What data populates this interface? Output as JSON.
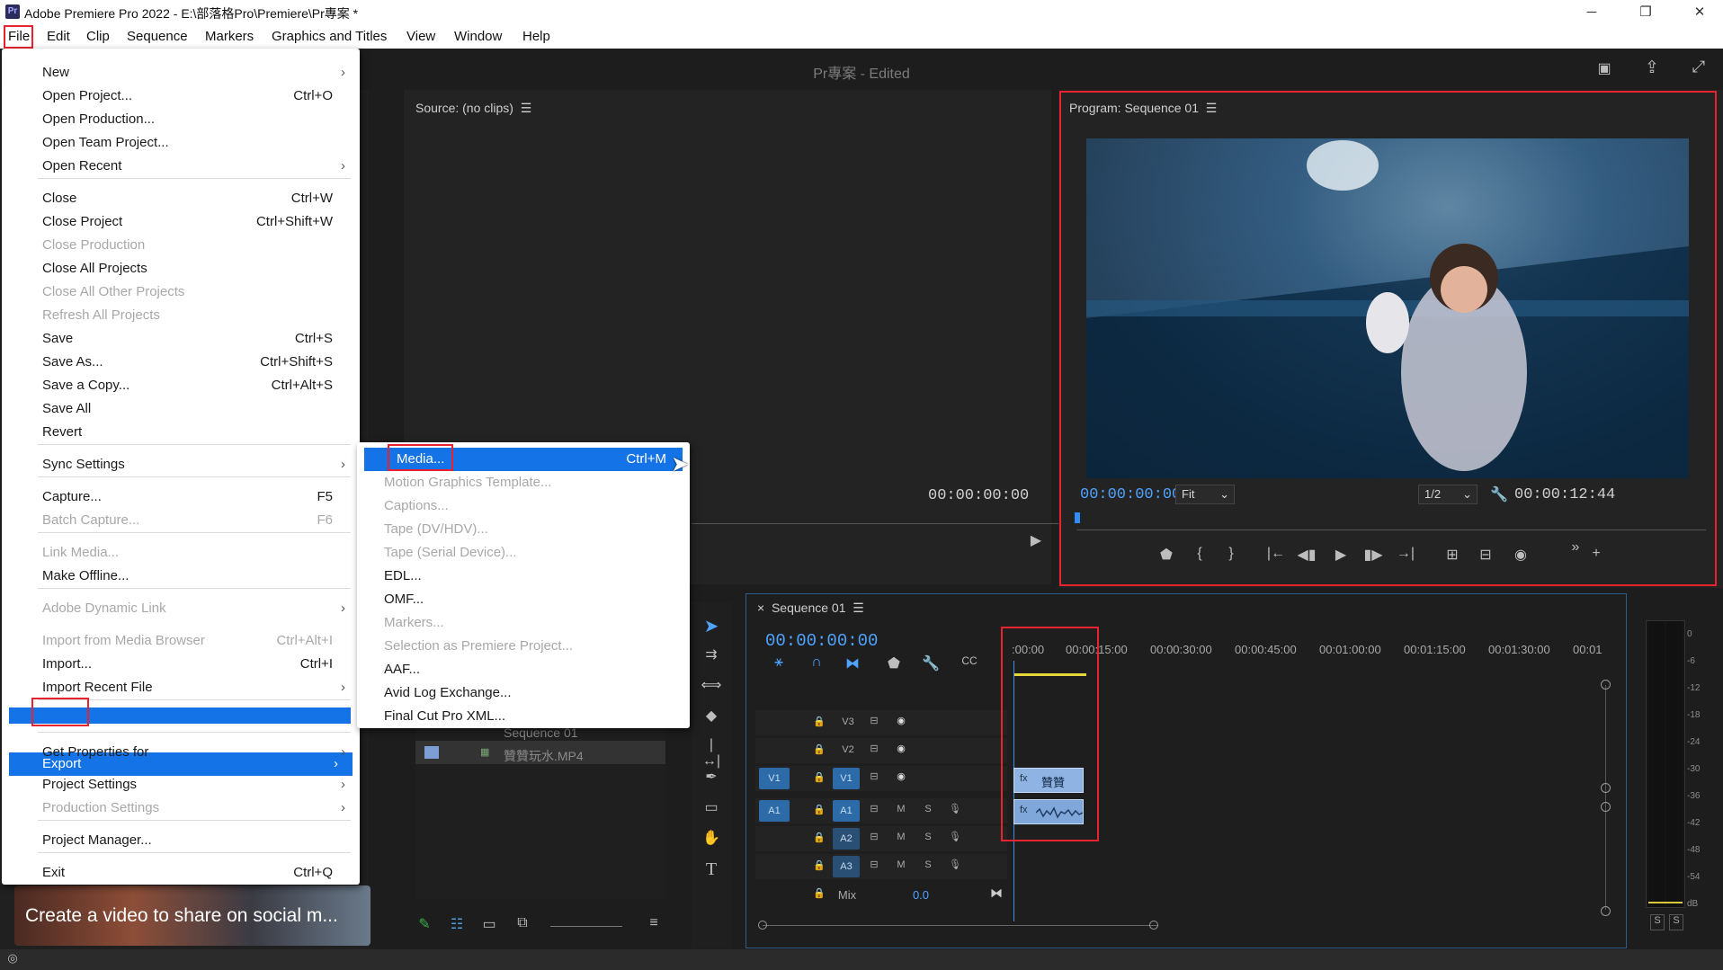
{
  "window": {
    "title": "Adobe Premiere Pro 2022 - E:\\部落格Pro\\Premiere\\Pr專案 *",
    "logo": "Pr",
    "minimize": "─",
    "maximize": "❐",
    "close": "✕"
  },
  "menubar": [
    "File",
    "Edit",
    "Clip",
    "Sequence",
    "Markers",
    "Graphics and Titles",
    "View",
    "Window",
    "Help"
  ],
  "appbar": {
    "project_name": "Pr專案",
    "status": " - Edited"
  },
  "file_menu": [
    {
      "label": "New",
      "sc": "",
      "sub": true,
      "dis": false
    },
    {
      "label": "Open Project...",
      "sc": "Ctrl+O",
      "sub": false,
      "dis": false
    },
    {
      "label": "Open Production...",
      "sc": "",
      "sub": false,
      "dis": false
    },
    {
      "label": "Open Team Project...",
      "sc": "",
      "sub": false,
      "dis": false
    },
    {
      "label": "Open Recent",
      "sc": "",
      "sub": true,
      "dis": false
    },
    {
      "label": "Close",
      "sc": "Ctrl+W",
      "sub": false,
      "dis": false
    },
    {
      "label": "Close Project",
      "sc": "Ctrl+Shift+W",
      "sub": false,
      "dis": false
    },
    {
      "label": "Close Production",
      "sc": "",
      "sub": false,
      "dis": true
    },
    {
      "label": "Close All Projects",
      "sc": "",
      "sub": false,
      "dis": false
    },
    {
      "label": "Close All Other Projects",
      "sc": "",
      "sub": false,
      "dis": true
    },
    {
      "label": "Refresh All Projects",
      "sc": "",
      "sub": false,
      "dis": true
    },
    {
      "label": "Save",
      "sc": "Ctrl+S",
      "sub": false,
      "dis": false
    },
    {
      "label": "Save As...",
      "sc": "Ctrl+Shift+S",
      "sub": false,
      "dis": false
    },
    {
      "label": "Save a Copy...",
      "sc": "Ctrl+Alt+S",
      "sub": false,
      "dis": false
    },
    {
      "label": "Save All",
      "sc": "",
      "sub": false,
      "dis": false
    },
    {
      "label": "Revert",
      "sc": "",
      "sub": false,
      "dis": false
    },
    {
      "label": "Sync Settings",
      "sc": "",
      "sub": true,
      "dis": false
    },
    {
      "label": "Capture...",
      "sc": "F5",
      "sub": false,
      "dis": false
    },
    {
      "label": "Batch Capture...",
      "sc": "F6",
      "sub": false,
      "dis": true
    },
    {
      "label": "Link Media...",
      "sc": "",
      "sub": false,
      "dis": true
    },
    {
      "label": "Make Offline...",
      "sc": "",
      "sub": false,
      "dis": false
    },
    {
      "label": "Adobe Dynamic Link",
      "sc": "",
      "sub": true,
      "dis": true
    },
    {
      "label": "Import from Media Browser",
      "sc": "Ctrl+Alt+I",
      "sub": false,
      "dis": true
    },
    {
      "label": "Import...",
      "sc": "Ctrl+I",
      "sub": false,
      "dis": false
    },
    {
      "label": "Import Recent File",
      "sc": "",
      "sub": true,
      "dis": false
    },
    {
      "label": "Export",
      "sc": "",
      "sub": true,
      "dis": false
    },
    {
      "label": "Get Properties for",
      "sc": "",
      "sub": true,
      "dis": false
    },
    {
      "label": "Project Settings",
      "sc": "",
      "sub": true,
      "dis": false
    },
    {
      "label": "Production Settings",
      "sc": "",
      "sub": true,
      "dis": true
    },
    {
      "label": "Project Manager...",
      "sc": "",
      "sub": false,
      "dis": false
    },
    {
      "label": "Exit",
      "sc": "Ctrl+Q",
      "sub": false,
      "dis": false
    }
  ],
  "export_menu": [
    {
      "label": "Media...",
      "sc": "Ctrl+M",
      "dis": false
    },
    {
      "label": "Motion Graphics Template...",
      "sc": "",
      "dis": true
    },
    {
      "label": "Captions...",
      "sc": "",
      "dis": true
    },
    {
      "label": "Tape (DV/HDV)...",
      "sc": "",
      "dis": true
    },
    {
      "label": "Tape (Serial Device)...",
      "sc": "",
      "dis": true
    },
    {
      "label": "EDL...",
      "sc": "",
      "dis": false
    },
    {
      "label": "OMF...",
      "sc": "",
      "dis": false
    },
    {
      "label": "Markers...",
      "sc": "",
      "dis": true
    },
    {
      "label": "Selection as Premiere Project...",
      "sc": "",
      "dis": true
    },
    {
      "label": "AAF...",
      "sc": "",
      "dis": false
    },
    {
      "label": "Avid Log Exchange...",
      "sc": "",
      "dis": false
    },
    {
      "label": "Final Cut Pro XML...",
      "sc": "",
      "dis": false
    }
  ],
  "source": {
    "title": "Source: (no clips)",
    "timecode": "00:00:00:00"
  },
  "program": {
    "title": "Program: Sequence 01",
    "timecode_left": "00:00:00:00",
    "fit": "Fit",
    "resolution": "1/2",
    "timecode_right": "00:00:12:44"
  },
  "project": {
    "items": [
      "Sequence 01",
      "贊贊玩水.MP4"
    ],
    "learn_banner": "Create a video to share on social m..."
  },
  "timeline": {
    "tab": "Sequence 01",
    "timecode": "00:00:00:00",
    "ruler": [
      ":00:00",
      "00:00:15:00",
      "00:00:30:00",
      "00:00:45:00",
      "00:01:00:00",
      "00:01:15:00",
      "00:01:30:00",
      "00:01"
    ],
    "tracks": [
      {
        "name": "V3",
        "src": ""
      },
      {
        "name": "V2",
        "src": ""
      },
      {
        "name": "V1",
        "src": "V1"
      },
      {
        "name": "A1",
        "src": "A1"
      },
      {
        "name": "A2",
        "src": ""
      },
      {
        "name": "A3",
        "src": ""
      }
    ],
    "mix_label": "Mix",
    "mix_value": "0.0",
    "clip_label": "贊贊"
  },
  "meter": {
    "scale": [
      "0",
      "-6",
      "-12",
      "-18",
      "-24",
      "-30",
      "-36",
      "-42",
      "-48",
      "-54",
      "dB"
    ],
    "solo": [
      "S",
      "S"
    ]
  }
}
